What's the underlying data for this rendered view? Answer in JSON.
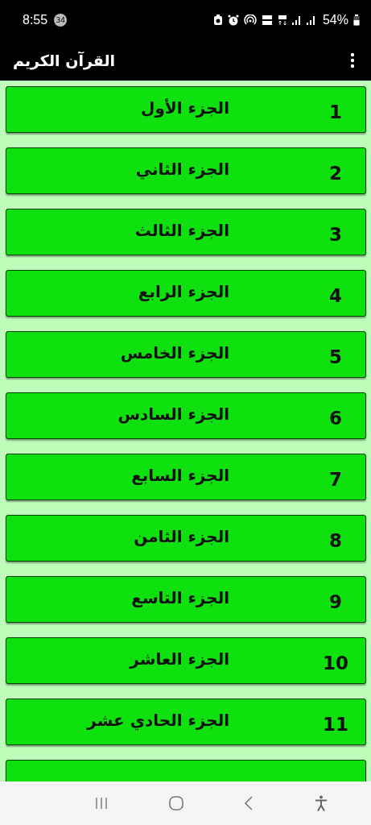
{
  "status_bar": {
    "time": "8:55",
    "notification_count": "34",
    "battery": "54%"
  },
  "app_bar": {
    "title": "القرآن الكريم"
  },
  "parts": [
    {
      "kind": "full",
      "number": "1",
      "name": "الجزء الأول"
    },
    {
      "kind": "full",
      "number": "2",
      "name": "الجزء الثاني"
    },
    {
      "kind": "full",
      "number": "3",
      "name": "الجزء الثالث"
    },
    {
      "kind": "full",
      "number": "4",
      "name": "الجزء الرابع"
    },
    {
      "kind": "full",
      "number": "5",
      "name": "الجزء الخامس"
    },
    {
      "kind": "full",
      "number": "6",
      "name": "الجزء السادس"
    },
    {
      "kind": "full",
      "number": "7",
      "name": "الجزء السابع"
    },
    {
      "kind": "full",
      "number": "8",
      "name": "الجزء الثامن"
    },
    {
      "kind": "full",
      "number": "9",
      "name": "الجزء التاسع"
    },
    {
      "kind": "full",
      "number": "10",
      "name": "الجزء العاشر"
    },
    {
      "kind": "full",
      "number": "11",
      "name": "الجزء الحادي عشر"
    },
    {
      "kind": "cut_off"
    }
  ]
}
